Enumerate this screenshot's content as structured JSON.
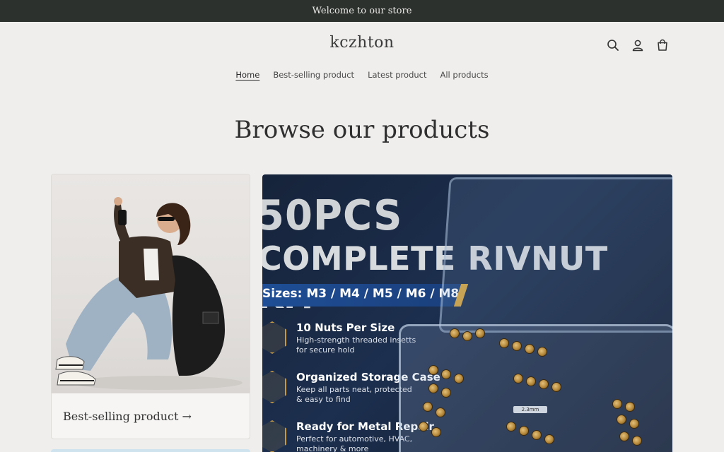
{
  "announcement": "Welcome to our store",
  "store_name": "kczhton",
  "header_icons": [
    "search-icon",
    "account-icon",
    "cart-icon"
  ],
  "nav": {
    "items": [
      {
        "label": "Home",
        "active": true
      },
      {
        "label": "Best-selling product",
        "active": false
      },
      {
        "label": "Latest product",
        "active": false
      },
      {
        "label": "All products",
        "active": false
      }
    ]
  },
  "page_heading": "Browse our products",
  "collections": [
    {
      "label": "Best-selling product →"
    }
  ],
  "banner": {
    "line1": "50PCS",
    "line2": "COMPLETE RIVNUT KIT",
    "sizes": "Sizes: M3 / M4 / M5 / M6 / M8",
    "features": [
      {
        "title": "10 Nuts Per Size",
        "desc": "High-strength threaded insetts for secure hold"
      },
      {
        "title": "Organized Storage Case",
        "desc": "Keep all parts neat, protected & easy to find"
      },
      {
        "title": "Ready for Metal Repair",
        "desc": "Perfect for automotive, HVAC, machinery & more"
      }
    ],
    "chip_label": "2.3mm"
  },
  "colors": {
    "announcement_bg": "#2d312e",
    "page_bg": "#efeeec",
    "banner_bg": "#16233a",
    "accent_gold": "#d8a640",
    "accent_blue": "#1f4e96"
  }
}
